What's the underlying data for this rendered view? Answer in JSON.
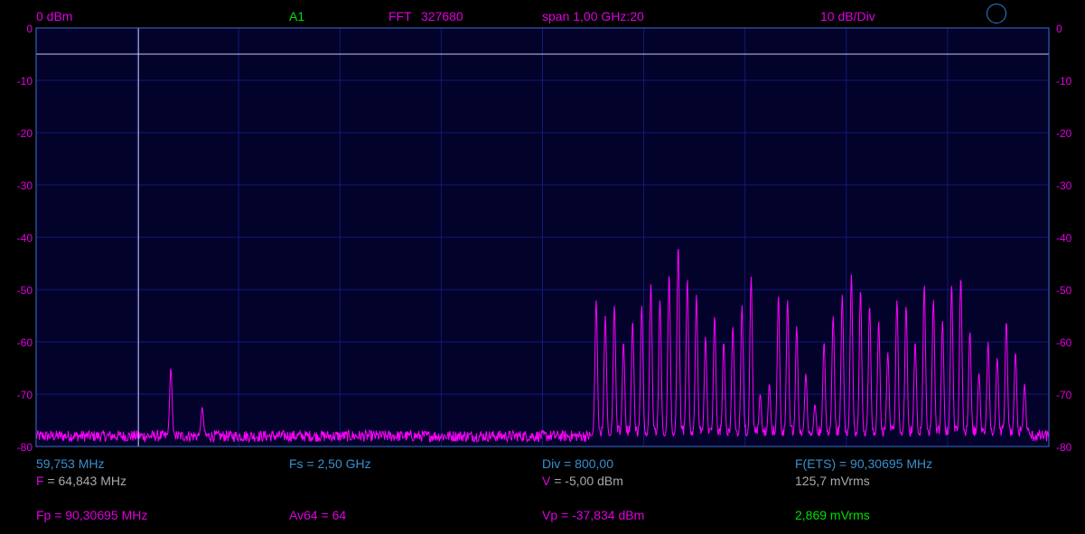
{
  "header": {
    "ref_level": "0 dBm",
    "channel": "A1",
    "fft_label": "FFT",
    "fft_size": "327680",
    "span": "span 1,00 GHz:20",
    "scale": "10 dB/Div"
  },
  "colors": {
    "background": "#000000",
    "plot_background": "#02022a",
    "grid": "#111a78",
    "border": "#3a70d0",
    "trace": "#ff00ff",
    "cursor": "#c8c8e8",
    "magenta_text": "#e000e0",
    "green_text": "#00e000",
    "blue_text": "#3a8fd0",
    "gray_text": "#a8a8a8"
  },
  "indicator_icon": "circle-indicator-icon",
  "y_axis_labels": [
    "0",
    "-10",
    "-20",
    "-30",
    "-40",
    "-50",
    "-60",
    "-70",
    "-80"
  ],
  "footer": {
    "row1": {
      "cursor_freq": "59,753 MHz",
      "fs": "Fs = 2,50 GHz",
      "div": "Div = 800,00",
      "f_ets": "F(ETS) = 90,30695 MHz"
    },
    "row2": {
      "f_label": "F",
      "f_value": " = 64,843 MHz",
      "v_label": "V",
      "v_value": " = -5,00 dBm",
      "mvrms": "125,7 mVrms"
    },
    "row3": {
      "fp": "Fp = 90,30695 MHz",
      "av": "Av64 = 64",
      "vp": "Vp = -37,834 dBm",
      "mvrms": "2,869 mVrms"
    }
  },
  "chart_data": {
    "type": "line",
    "ylim": [
      -80,
      0
    ],
    "y_unit": "dBm",
    "y_ticks": [
      0,
      -10,
      -20,
      -30,
      -40,
      -50,
      -60,
      -70,
      -80
    ],
    "grid": true,
    "cursor": {
      "vertical_freq_fraction": 0.101,
      "horizontal_level_dbm": -5
    },
    "noise_floor_dbm": -78,
    "series": [
      {
        "peaks": [
          {
            "x": 0.133,
            "y": -65
          },
          {
            "x": 0.164,
            "y": -72.5
          },
          {
            "x": 0.553,
            "y": -52
          },
          {
            "x": 0.562,
            "y": -55
          },
          {
            "x": 0.571,
            "y": -53
          },
          {
            "x": 0.58,
            "y": -60
          },
          {
            "x": 0.589,
            "y": -56
          },
          {
            "x": 0.598,
            "y": -53
          },
          {
            "x": 0.607,
            "y": -49
          },
          {
            "x": 0.616,
            "y": -52
          },
          {
            "x": 0.625,
            "y": -47
          },
          {
            "x": 0.634,
            "y": -41.5
          },
          {
            "x": 0.643,
            "y": -48
          },
          {
            "x": 0.652,
            "y": -51
          },
          {
            "x": 0.661,
            "y": -59
          },
          {
            "x": 0.67,
            "y": -55
          },
          {
            "x": 0.679,
            "y": -60
          },
          {
            "x": 0.688,
            "y": -57
          },
          {
            "x": 0.697,
            "y": -53
          },
          {
            "x": 0.706,
            "y": -47.5
          },
          {
            "x": 0.715,
            "y": -70
          },
          {
            "x": 0.724,
            "y": -68
          },
          {
            "x": 0.733,
            "y": -51
          },
          {
            "x": 0.742,
            "y": -52
          },
          {
            "x": 0.751,
            "y": -57
          },
          {
            "x": 0.76,
            "y": -66
          },
          {
            "x": 0.769,
            "y": -72
          },
          {
            "x": 0.778,
            "y": -60
          },
          {
            "x": 0.787,
            "y": -55
          },
          {
            "x": 0.796,
            "y": -51
          },
          {
            "x": 0.805,
            "y": -47
          },
          {
            "x": 0.814,
            "y": -50
          },
          {
            "x": 0.823,
            "y": -53
          },
          {
            "x": 0.832,
            "y": -56
          },
          {
            "x": 0.841,
            "y": -62
          },
          {
            "x": 0.85,
            "y": -52
          },
          {
            "x": 0.859,
            "y": -53
          },
          {
            "x": 0.868,
            "y": -60
          },
          {
            "x": 0.877,
            "y": -49
          },
          {
            "x": 0.886,
            "y": -52
          },
          {
            "x": 0.895,
            "y": -56
          },
          {
            "x": 0.904,
            "y": -49
          },
          {
            "x": 0.913,
            "y": -47.5
          },
          {
            "x": 0.922,
            "y": -58
          },
          {
            "x": 0.931,
            "y": -66
          },
          {
            "x": 0.94,
            "y": -60
          },
          {
            "x": 0.949,
            "y": -63
          },
          {
            "x": 0.958,
            "y": -56
          },
          {
            "x": 0.967,
            "y": -62
          },
          {
            "x": 0.976,
            "y": -68
          }
        ]
      }
    ]
  }
}
